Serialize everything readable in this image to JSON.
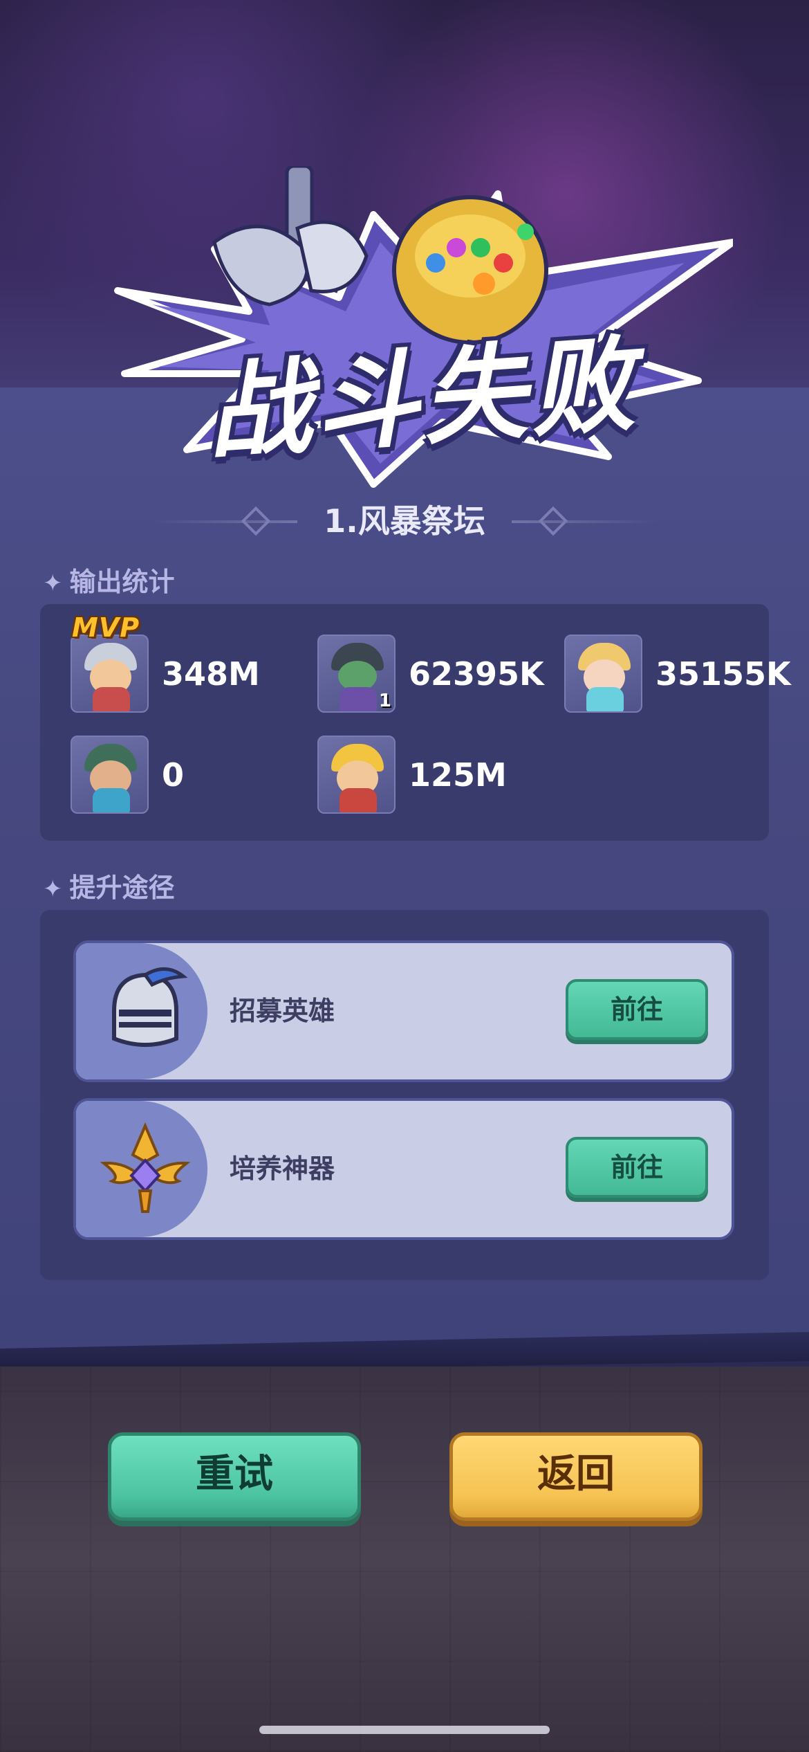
{
  "result": {
    "title": "战斗失败",
    "stage_name": "1.风暴祭坛"
  },
  "damage_stats": {
    "heading": "输出统计",
    "mvp_label": "MVP",
    "heroes": [
      {
        "value": "348M",
        "mvp": true,
        "icon": "hero-thor-icon",
        "level_badge": ""
      },
      {
        "value": "62395K",
        "mvp": false,
        "icon": "hero-dark-knight-icon",
        "level_badge": "1"
      },
      {
        "value": "35155K",
        "mvp": false,
        "icon": "hero-ice-girl-icon",
        "level_badge": ""
      },
      {
        "value": "0",
        "mvp": false,
        "icon": "hero-poseidon-icon",
        "level_badge": ""
      },
      {
        "value": "125M",
        "mvp": false,
        "icon": "hero-king-icon",
        "level_badge": ""
      }
    ]
  },
  "improve": {
    "heading": "提升途径",
    "items": [
      {
        "label": "招募英雄",
        "button": "前往",
        "icon": "knight-helmet-icon"
      },
      {
        "label": "培养神器",
        "button": "前往",
        "icon": "winged-artifact-icon"
      }
    ]
  },
  "buttons": {
    "retry": "重试",
    "back": "返回"
  },
  "colors": {
    "go_green": "#4cc3a0",
    "back_yellow": "#f5c352",
    "panel": "#393b6d",
    "mvp_gold": "#ffc02e"
  }
}
